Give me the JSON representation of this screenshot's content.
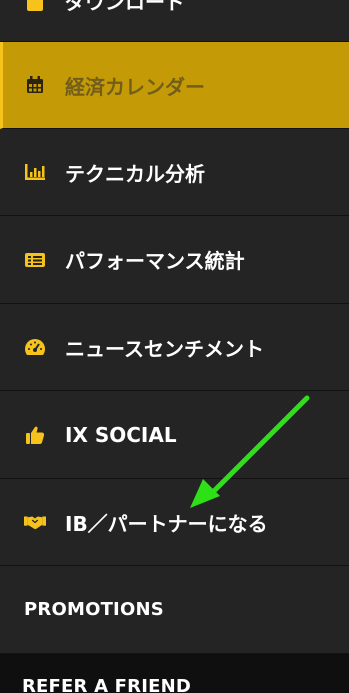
{
  "menu": {
    "items": [
      {
        "label": "ダウンロード",
        "icon": "download-icon"
      },
      {
        "label": "経済カレンダー",
        "icon": "calendar-icon"
      },
      {
        "label": "テクニカル分析",
        "icon": "bar-chart-icon"
      },
      {
        "label": "パフォーマンス統計",
        "icon": "stats-card-icon"
      },
      {
        "label": "ニュースセンチメント",
        "icon": "gauge-icon"
      },
      {
        "label": "IX SOCIAL",
        "icon": "thumbs-up-icon"
      },
      {
        "label": "IB／パートナーになる",
        "icon": "handshake-icon"
      },
      {
        "label": "PROMOTIONS"
      },
      {
        "label": "REFER A FRIEND"
      }
    ]
  },
  "colors": {
    "accent": "#f6c21c",
    "active_bg": "#c49b06",
    "arrow": "#2ee016"
  }
}
